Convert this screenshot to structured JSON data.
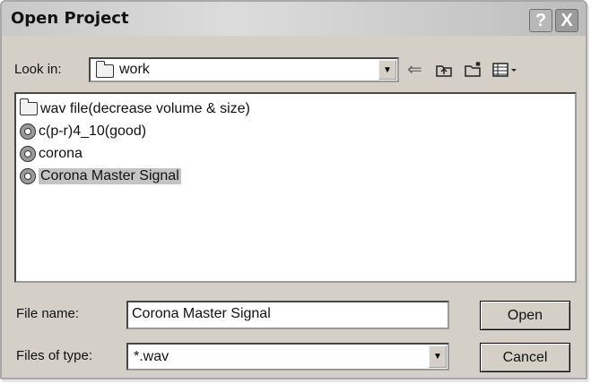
{
  "window": {
    "title": "Open Project",
    "help_label": "?",
    "close_label": "X"
  },
  "look_in": {
    "label": "Look in:",
    "value": "work",
    "icon": "folder-icon"
  },
  "toolbar": {
    "back_icon": "back-arrow-icon",
    "up_icon": "up-one-level-icon",
    "new_folder_icon": "new-folder-icon",
    "view_menu_icon": "view-menu-icon"
  },
  "files": [
    {
      "name": "wav file(decrease volume & size)",
      "icon": "folder-icon"
    },
    {
      "name": "c(p-r)4_10(good)",
      "icon": "wav-file-icon"
    },
    {
      "name": "corona",
      "icon": "wav-file-icon"
    },
    {
      "name": "Corona Master Signal",
      "icon": "wav-file-icon",
      "selected": true
    }
  ],
  "file_name": {
    "label": "File name:",
    "value": "Corona Master Signal"
  },
  "file_type": {
    "label": "Files of type:",
    "value": "*.wav"
  },
  "buttons": {
    "open": "Open",
    "cancel": "Cancel"
  }
}
